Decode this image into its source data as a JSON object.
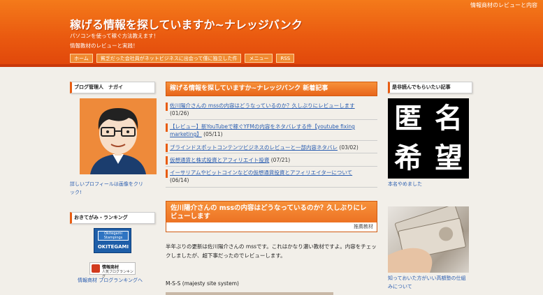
{
  "header": {
    "top_right": "情報商材のレビューと内容",
    "site_title": "稼げる情報を探していますか~ナレッジバンク",
    "tagline_1": "パソコンを使って稼ぐ方法教えます！",
    "tagline_2": "情報教材のレビューと実践！",
    "nav": [
      "ホーム",
      "貧乏だった会社員がネットビジネスに出会って僅に独立した件",
      "メニュー",
      "RSS"
    ]
  },
  "left_sidebar": {
    "profile_title": "ブログ管理人　ナガイ",
    "profile_link": "詳しいプロフィールは画像をクリック!",
    "ranking_title": "おきてがみ・ランキング",
    "okitegami_stamp": "Okitegami Stampings",
    "okitegami_word": "OKITEGAMI",
    "rank_badge_line1": "情報商材",
    "rank_badge_line2": "人気ブログランキング",
    "rank_link": "情報商材 ブログランキングへ"
  },
  "main": {
    "new_title": "稼げる情報を探していますか~ナレッジバンク 新着記事",
    "articles": [
      {
        "title": "佐川陽介さんの mssの内容はどうなっているのか？久しぶりにレビューします",
        "date": "(01/26)"
      },
      {
        "title": "【レビュー】新YouTubeで稼ぐYFMの内容をネタバレする件【youtube fixing marketing】",
        "date": "(05/11)"
      },
      {
        "title": "ブラインドスポットコンテンツビジネスのレビューと一部内容ネタバレ",
        "date": "(03/02)"
      },
      {
        "title": "仮想通貨と株式投資とアフィリエイト投資",
        "date": "(07/21)"
      },
      {
        "title": "イーサリアムやビットコインなどの仮想通貨投資とアフィリエイターについて",
        "date": "(06/14)"
      }
    ],
    "post_title": "佐川陽介さんの mssの内容はどうなっているのか？久しぶりにレビューします",
    "post_category": "推薦教材",
    "post_body": "半年ぶりの更新は佐川陽介さんの mssです。これはかなり濃い教材ですよ。内容をチェックしましたが、超下事だったのでレビューします。",
    "post_body_2": "M-S-S (majesty site system)"
  },
  "right_sidebar": {
    "title": "是非読んでもらいたい記事",
    "anon_chars": [
      "匿",
      "名",
      "希",
      "望"
    ],
    "anon_caption": "本名やめました",
    "money_caption": "知っておいた方がいい高額塾の仕組みについて"
  },
  "colors": {
    "header_orange": "#ea5a10",
    "accent": "#e85d12",
    "link": "#2a5db0"
  }
}
